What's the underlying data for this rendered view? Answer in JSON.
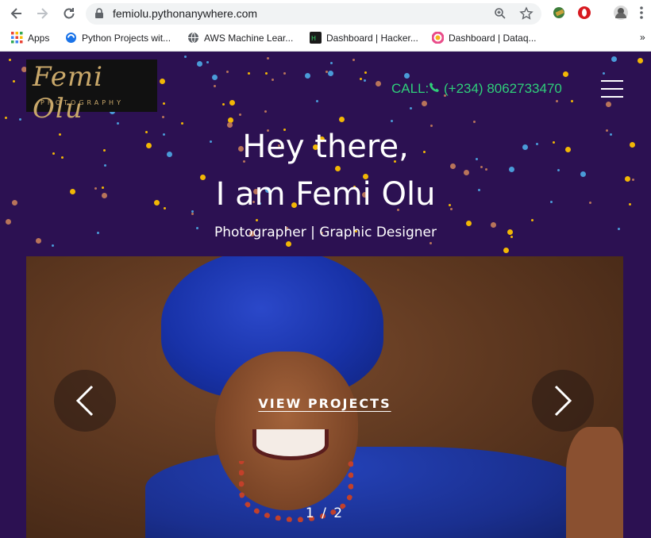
{
  "browser": {
    "url": "femiolu.pythonanywhere.com",
    "bookmarks": [
      {
        "label": "Apps",
        "icon": "apps-grid-icon"
      },
      {
        "label": "Python Projects wit...",
        "icon": "python-projects-icon"
      },
      {
        "label": "AWS Machine Lear...",
        "icon": "globe-icon"
      },
      {
        "label": "Dashboard | Hacker...",
        "icon": "hackerrank-icon"
      },
      {
        "label": "Dashboard | Dataq...",
        "icon": "dataquest-icon"
      }
    ],
    "more_bookmarks": "»"
  },
  "site": {
    "logo": {
      "script": "Femi Olu",
      "subtitle": "PHOTOGRAPHY"
    },
    "call_label": "CALL:",
    "phone": "(+234) 8062733470",
    "hero": {
      "line1": "Hey there,",
      "line2": "I am Femi Olu",
      "subtitle": "Photographer | Graphic Designer"
    },
    "carousel": {
      "cta": "VIEW PROJECTS",
      "counter": "1 / 2"
    }
  },
  "colors": {
    "background": "#2c1152",
    "accent_green": "#2fcf7a",
    "dot_gold": "#f2b705",
    "dot_blue": "#4a9bd8",
    "dot_brown": "#b8745a"
  }
}
